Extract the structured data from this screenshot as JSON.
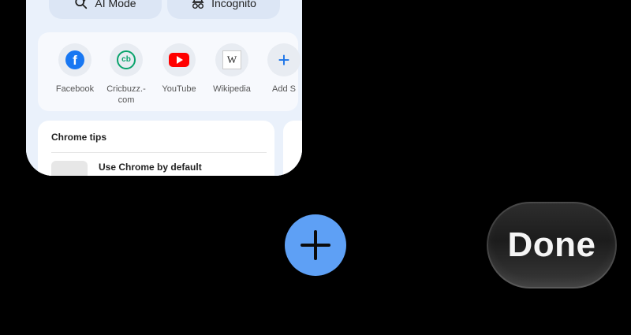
{
  "tab_preview": {
    "pills": {
      "ai_mode": "AI Mode",
      "incognito": "Incognito"
    },
    "shortcuts": [
      {
        "label": "Facebook",
        "icon": "facebook-icon"
      },
      {
        "label": "Cricbuzz.-\ncom",
        "icon": "cricbuzz-icon",
        "logo_text": "cb"
      },
      {
        "label": "YouTube",
        "icon": "youtube-icon"
      },
      {
        "label": "Wikipedia",
        "icon": "wikipedia-icon",
        "logo_text": "W"
      },
      {
        "label": "Add S",
        "icon": "plus-icon"
      }
    ],
    "tips": {
      "title": "Chrome tips",
      "first_tip": "Use Chrome by default"
    }
  },
  "controls": {
    "done_label": "Done",
    "new_tab_icon": "plus-icon"
  },
  "colors": {
    "new_tab_accent": "#5ea0f5",
    "facebook": "#1877f2",
    "youtube": "#ff0000",
    "cricbuzz": "#0aa36c"
  }
}
